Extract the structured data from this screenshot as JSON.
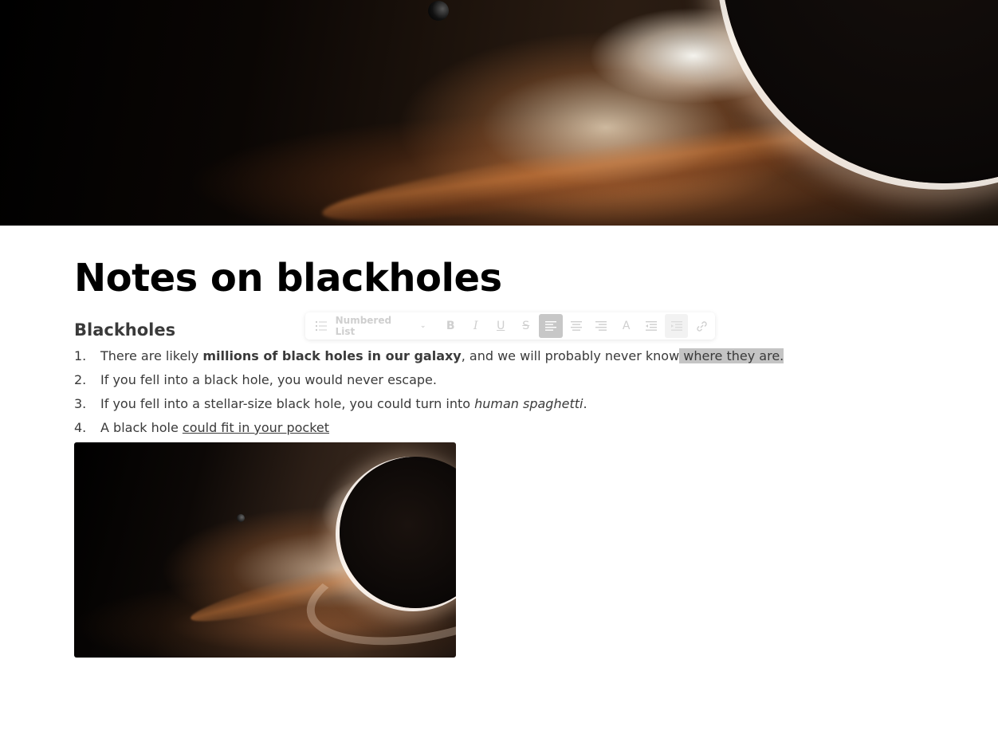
{
  "page": {
    "title": "Notes on blackholes",
    "section_heading": "Blackholes"
  },
  "list": {
    "items": [
      {
        "number": "1.",
        "before": "There are likely ",
        "bold": "millions of black holes in our galaxy",
        "middle": ", and we will probably never know",
        "highlighted": " where they are."
      },
      {
        "number": "2.",
        "text": "If you fell into a black hole, you would never escape."
      },
      {
        "number": "3.",
        "before": "If you fell into a stellar-size black hole, you could turn into ",
        "italic": "human spaghetti",
        "after": "."
      },
      {
        "number": "4.",
        "before": "A black hole ",
        "underlined": "could fit in your pocket"
      }
    ]
  },
  "toolbar": {
    "block_type_label": "Numbered List",
    "block_type_icon": "numbered-list-icon",
    "buttons": [
      {
        "name": "bold",
        "glyph": "B",
        "active": false
      },
      {
        "name": "italic",
        "glyph": "I",
        "active": false
      },
      {
        "name": "underline",
        "glyph": "U",
        "active": false
      },
      {
        "name": "strikethrough",
        "glyph": "S",
        "active": false
      },
      {
        "name": "align-left",
        "active": true
      },
      {
        "name": "align-center",
        "active": false
      },
      {
        "name": "align-right",
        "active": false
      },
      {
        "name": "text-color",
        "glyph": "A",
        "active": false
      },
      {
        "name": "outdent",
        "active": false
      },
      {
        "name": "indent",
        "active": false
      },
      {
        "name": "link",
        "active": false
      }
    ]
  },
  "colors": {
    "highlight": "#c4c4c4",
    "text": "#3a3a3a",
    "title": "#000000",
    "toolbar_active": "#c7c7c7"
  }
}
